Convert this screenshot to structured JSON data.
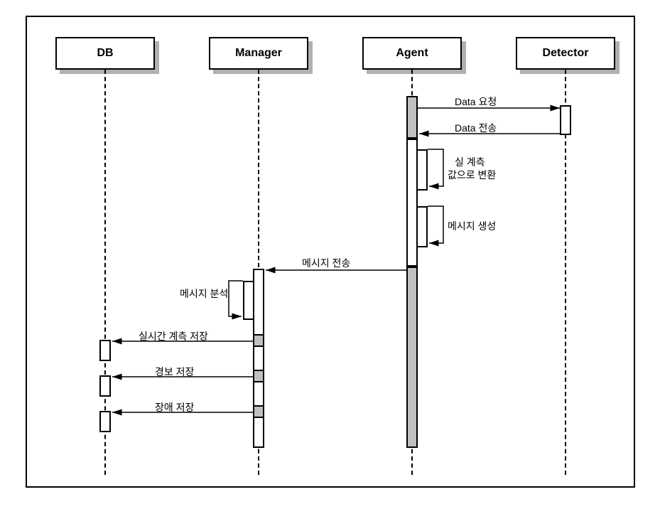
{
  "participants": {
    "db": "DB",
    "manager": "Manager",
    "agent": "Agent",
    "detector": "Detector"
  },
  "messages": {
    "data_request": "Data 요청",
    "data_send": "Data 전송",
    "convert_line1": "실 계측",
    "convert_line2": "값으로 변환",
    "msg_create": "메시지 생성",
    "msg_send": "메시지 전송",
    "msg_analyze": "메시지 분석",
    "rt_store": "실시간 계측 저장",
    "alarm_store": "경보 저장",
    "fault_store": "장애 저장"
  }
}
